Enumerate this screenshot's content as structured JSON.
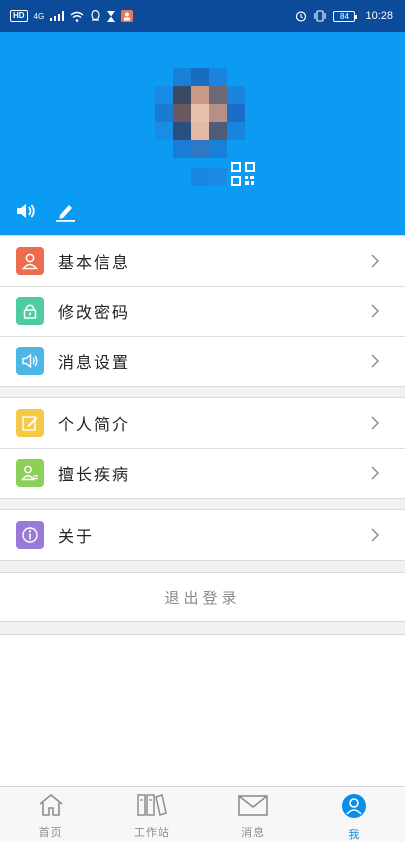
{
  "status_bar": {
    "hd": "HD",
    "network": "4G",
    "battery": "84",
    "time": "10:28"
  },
  "profile": {
    "qr_icon": "qr-code-icon",
    "speaker_icon": "speaker-icon",
    "edit_icon": "edit-icon"
  },
  "menu_groups": [
    [
      {
        "label": "基本信息",
        "icon": "user-icon",
        "color": "#ef6b4e"
      },
      {
        "label": "修改密码",
        "icon": "lock-icon",
        "color": "#4ecba0"
      },
      {
        "label": "消息设置",
        "icon": "speaker-icon",
        "color": "#4cb6e6"
      }
    ],
    [
      {
        "label": "个人简介",
        "icon": "edit-icon",
        "color": "#f4c945"
      },
      {
        "label": "擅长疾病",
        "icon": "user-list-icon",
        "color": "#8cd05c"
      }
    ],
    [
      {
        "label": "关于",
        "icon": "info-icon",
        "color": "#9a7ad6"
      }
    ]
  ],
  "logout": {
    "label": "退出登录"
  },
  "bottom_nav": [
    {
      "label": "首页",
      "icon": "home-icon",
      "active": false
    },
    {
      "label": "工作站",
      "icon": "workstation-icon",
      "active": false
    },
    {
      "label": "消息",
      "icon": "mail-icon",
      "active": false
    },
    {
      "label": "我",
      "icon": "profile-icon",
      "active": true
    }
  ],
  "colors": {
    "status_bar": "#0c4a9a",
    "header": "#0b9bf2",
    "active_tab": "#0b8ee8"
  }
}
